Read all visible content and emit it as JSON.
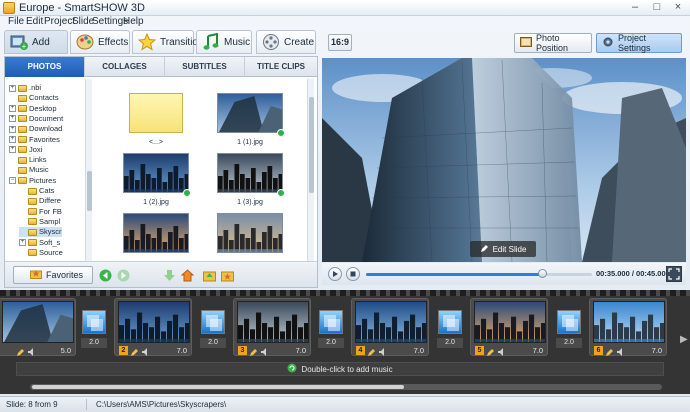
{
  "window": {
    "title": "Europe - SmartSHOW 3D",
    "controls": [
      "–",
      "□",
      "×"
    ]
  },
  "menu": [
    "File",
    "Edit",
    "Project",
    "Slide",
    "Settings",
    "Help"
  ],
  "toolbar": {
    "tabs": [
      {
        "label": "Add",
        "icon": "add-photo-icon"
      },
      {
        "label": "Effects",
        "icon": "palette-icon"
      },
      {
        "label": "Transitions",
        "icon": "star-icon"
      },
      {
        "label": "Music",
        "icon": "music-note-icon"
      },
      {
        "label": "Create",
        "icon": "film-reel-icon"
      }
    ],
    "active_tab": "Add",
    "ratio": "16:9",
    "photo_position": "Photo Position",
    "project_settings": "Project Settings"
  },
  "subtabs": [
    "PHOTOS",
    "COLLAGES",
    "SUBTITLES",
    "TITLE CLIPS"
  ],
  "active_subtab": "PHOTOS",
  "tree": [
    {
      "label": ".nbi",
      "level": 1,
      "expander": "+"
    },
    {
      "label": "Contacts",
      "level": 1,
      "expander": ""
    },
    {
      "label": "Desktop",
      "level": 1,
      "expander": "+"
    },
    {
      "label": "Document",
      "level": 1,
      "expander": "+"
    },
    {
      "label": "Download",
      "level": 1,
      "expander": "+"
    },
    {
      "label": "Favorites",
      "level": 1,
      "expander": "+"
    },
    {
      "label": "Joxi",
      "level": 1,
      "expander": "+"
    },
    {
      "label": "Links",
      "level": 1,
      "expander": ""
    },
    {
      "label": "Music",
      "level": 1,
      "expander": ""
    },
    {
      "label": "Pictures",
      "level": 1,
      "expander": "−"
    },
    {
      "label": "Cats",
      "level": 2,
      "expander": ""
    },
    {
      "label": "Differe",
      "level": 2,
      "expander": ""
    },
    {
      "label": "For FB",
      "level": 2,
      "expander": ""
    },
    {
      "label": "Sampl",
      "level": 2,
      "expander": ""
    },
    {
      "label": "Skyscr",
      "level": 2,
      "expander": "",
      "selected": true
    },
    {
      "label": "Soft_s",
      "level": 2,
      "expander": "+"
    },
    {
      "label": "Source",
      "level": 2,
      "expander": ""
    }
  ],
  "thumbs": [
    {
      "label": "<...>",
      "kind": "folder",
      "check": false
    },
    {
      "label": "1 (1).jpg",
      "kind": "sky-up",
      "check": true
    },
    {
      "label": "1 (2).jpg",
      "kind": "city-blue",
      "check": true
    },
    {
      "label": "1 (3).jpg",
      "kind": "city-dusk",
      "check": true
    },
    {
      "label": "",
      "kind": "city-sunset",
      "check": false
    },
    {
      "label": "",
      "kind": "city-warm",
      "check": false
    }
  ],
  "favorites": "Favorites",
  "preview": {
    "edit_slide": "Edit Slide",
    "progress": 0.78,
    "time": "00:35.000 / 00:45.000"
  },
  "timeline": {
    "slides": [
      {
        "num": "",
        "dur": "5.0",
        "kind": "sky-up"
      },
      {
        "num": "2",
        "dur": "7.0",
        "kind": "city-blue"
      },
      {
        "num": "3",
        "dur": "7.0",
        "kind": "city-dusk"
      },
      {
        "num": "4",
        "dur": "7.0",
        "kind": "city-blue2"
      },
      {
        "num": "5",
        "dur": "7.0",
        "kind": "city-sunset"
      },
      {
        "num": "6",
        "dur": "7.0",
        "kind": "city-day"
      }
    ],
    "transitions": [
      "2.0",
      "2.0",
      "2.0",
      "2.0",
      "2.0"
    ],
    "audio_hint": "Double-click to add music"
  },
  "status": {
    "slide": "Slide: 8 from 9",
    "path": "C:\\Users\\AMS\\Pictures\\Skyscrapers\\"
  }
}
